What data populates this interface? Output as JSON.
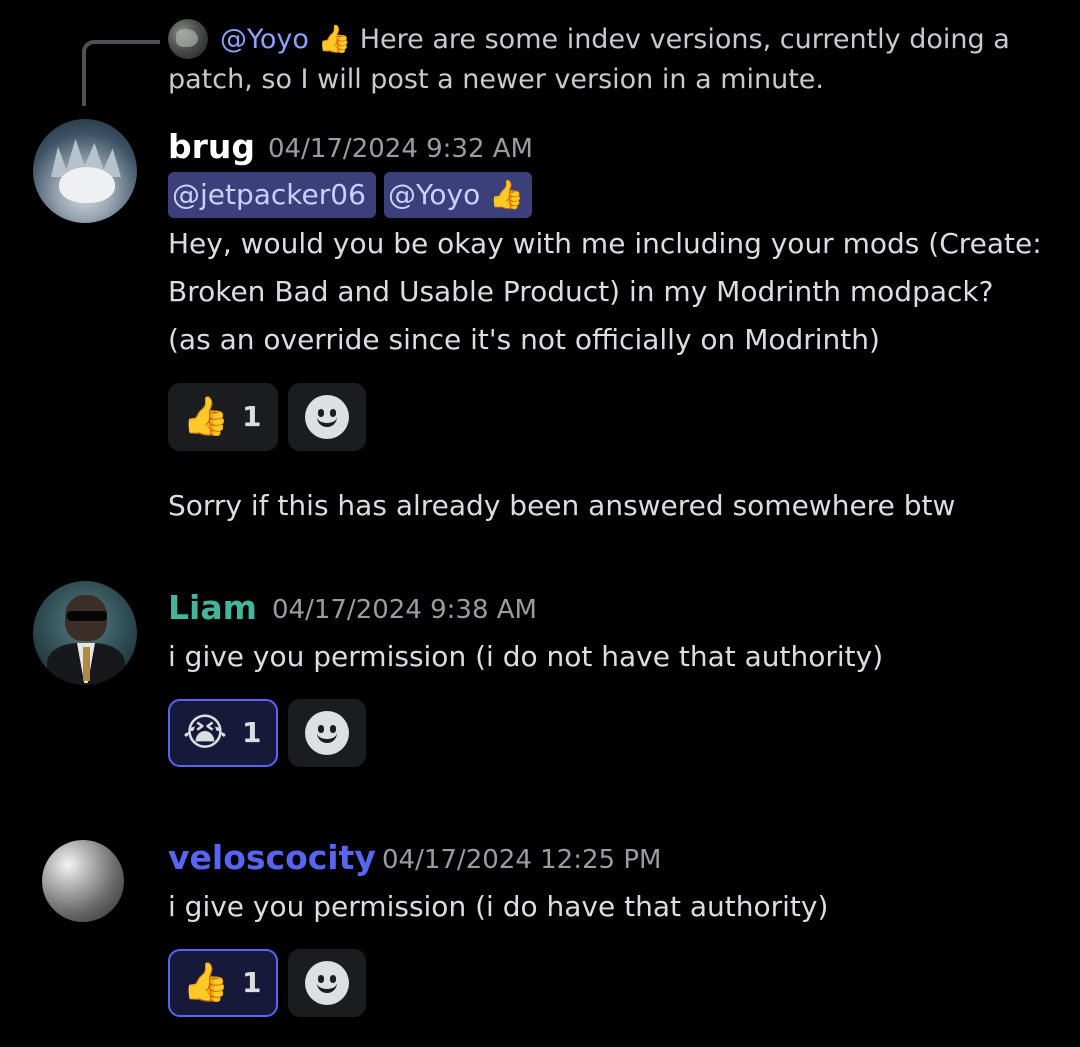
{
  "reply": {
    "mention": "@Yoyo",
    "mention_emoji": "👍",
    "text": "Here are some indev versions, currently doing a patch, so I will post a newer version in a  minute."
  },
  "messages": [
    {
      "username": "brug",
      "username_color": "#ffffff",
      "timestamp": "04/17/2024 9:32 AM",
      "mentions": [
        "@jetpacker06",
        "@Yoyo"
      ],
      "mention_emoji": "👍",
      "lines": [
        "Hey, would you be okay with me including your mods (Create:",
        "Broken Bad and Usable Product) in my Modrinth modpack?",
        "(as an override since it's not officially on Modrinth)"
      ],
      "reaction": {
        "emoji": "👍",
        "count": "1"
      },
      "followup": "Sorry if this has already been answered somewhere btw"
    },
    {
      "username": "Liam",
      "username_color": "#43b59a",
      "timestamp": "04/17/2024 9:38 AM",
      "text": "i give you permission (i do not have that authority)",
      "reaction": {
        "emoji": "😭",
        "count": "1"
      }
    },
    {
      "username": "veloscocity",
      "username_color": "#5865f2",
      "timestamp": "04/17/2024 12:25 PM",
      "text": "i give you permission (i do have that authority)",
      "reaction": {
        "emoji": "👍",
        "count": "1"
      }
    }
  ]
}
